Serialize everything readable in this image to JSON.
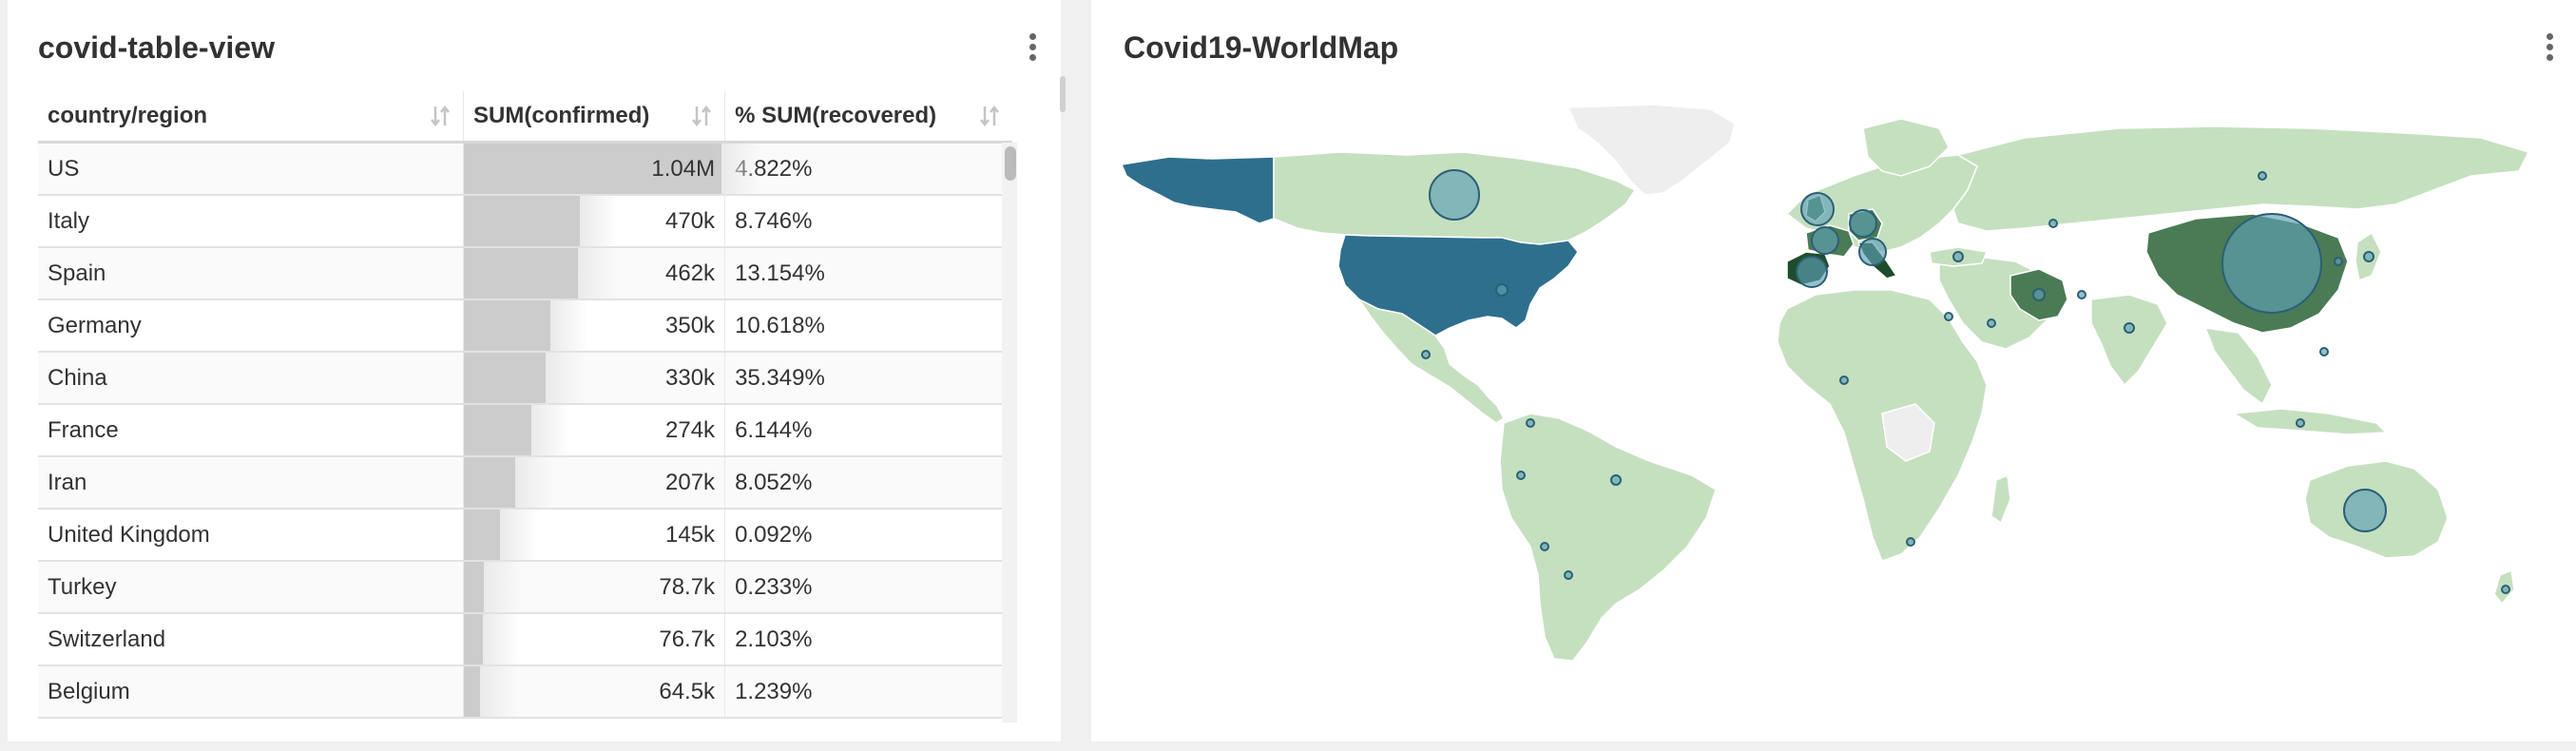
{
  "table_panel": {
    "title": "covid-table-view",
    "columns": [
      "country/region",
      "SUM(confirmed)",
      "% SUM(recovered)"
    ],
    "rows": [
      {
        "country": "US",
        "confirmed": "1.04M",
        "confirmed_value": 1040000,
        "recovered_pct": "4.822%"
      },
      {
        "country": "Italy",
        "confirmed": "470k",
        "confirmed_value": 470000,
        "recovered_pct": "8.746%"
      },
      {
        "country": "Spain",
        "confirmed": "462k",
        "confirmed_value": 462000,
        "recovered_pct": "13.154%"
      },
      {
        "country": "Germany",
        "confirmed": "350k",
        "confirmed_value": 350000,
        "recovered_pct": "10.618%"
      },
      {
        "country": "China",
        "confirmed": "330k",
        "confirmed_value": 330000,
        "recovered_pct": "35.349%"
      },
      {
        "country": "France",
        "confirmed": "274k",
        "confirmed_value": 274000,
        "recovered_pct": "6.144%"
      },
      {
        "country": "Iran",
        "confirmed": "207k",
        "confirmed_value": 207000,
        "recovered_pct": "8.052%"
      },
      {
        "country": "United Kingdom",
        "confirmed": "145k",
        "confirmed_value": 145000,
        "recovered_pct": "0.092%"
      },
      {
        "country": "Turkey",
        "confirmed": "78.7k",
        "confirmed_value": 78700,
        "recovered_pct": "0.233%"
      },
      {
        "country": "Switzerland",
        "confirmed": "76.7k",
        "confirmed_value": 76700,
        "recovered_pct": "2.103%"
      },
      {
        "country": "Belgium",
        "confirmed": "64.5k",
        "confirmed_value": 64500,
        "recovered_pct": "1.239%"
      }
    ],
    "max_confirmed": 1040000
  },
  "map_panel": {
    "title": "Covid19-WorldMap",
    "colors": {
      "land_default": "#c5e0bf",
      "land_nodata": "#eeeeee",
      "border": "#ffffff",
      "highlight_blue": "#2e6f8e",
      "highlight_dark_green": "#4a7b55",
      "highlight_darkest": "#1e4d2b",
      "bubble_fill": "#5e9fb3",
      "bubble_stroke": "#2b5f76"
    }
  },
  "icons": {
    "menu": "kebab-menu-icon",
    "sort": "sort-arrows-icon"
  }
}
